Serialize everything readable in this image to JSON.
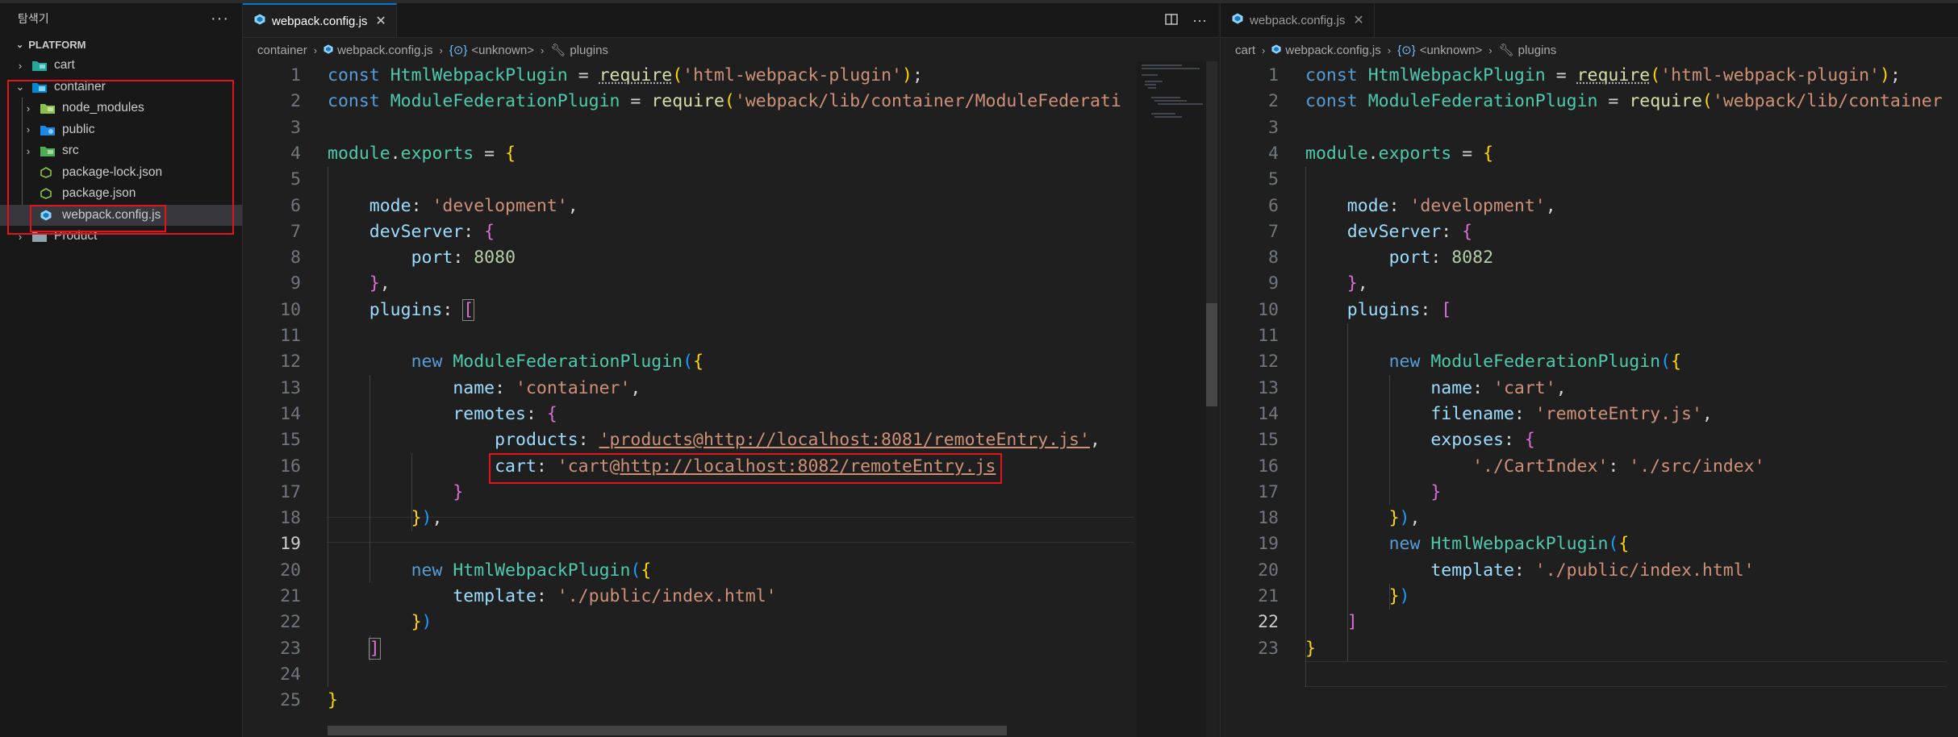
{
  "explorer": {
    "title": "탐색기",
    "more": "···",
    "root": "PLATFORM",
    "items": [
      {
        "label": "cart"
      },
      {
        "label": "container"
      },
      {
        "label": "node_modules"
      },
      {
        "label": "public"
      },
      {
        "label": "src"
      },
      {
        "label": "package-lock.json"
      },
      {
        "label": "package.json"
      },
      {
        "label": "webpack.config.js"
      },
      {
        "label": "Product"
      }
    ]
  },
  "left_editor": {
    "tab": {
      "label": "webpack.config.js",
      "close": "✕"
    },
    "breadcrumb": [
      "container",
      "webpack.config.js",
      "<unknown>",
      "plugins"
    ],
    "line_numbers": [
      "1",
      "2",
      "3",
      "4",
      "5",
      "6",
      "7",
      "8",
      "9",
      "10",
      "11",
      "12",
      "13",
      "14",
      "15",
      "16",
      "17",
      "18",
      "19",
      "20",
      "21",
      "22",
      "23",
      "24",
      "25"
    ],
    "current_line": "19"
  },
  "right_editor": {
    "tab": {
      "label": "webpack.config.js",
      "close": "✕"
    },
    "breadcrumb": [
      "cart",
      "webpack.config.js",
      "<unknown>",
      "plugins"
    ],
    "line_numbers": [
      "1",
      "2",
      "3",
      "4",
      "5",
      "6",
      "7",
      "8",
      "9",
      "10",
      "11",
      "12",
      "13",
      "14",
      "15",
      "16",
      "17",
      "18",
      "19",
      "20",
      "21",
      "22",
      "23"
    ],
    "current_line": "22"
  },
  "colors": {
    "keyword": "#569cd6",
    "class": "#4ec9b0",
    "string": "#ce9178",
    "property": "#9cdcfe",
    "number": "#b5cea8",
    "highlight_box": "#e0141a",
    "tab_accent": "#0078d4"
  }
}
